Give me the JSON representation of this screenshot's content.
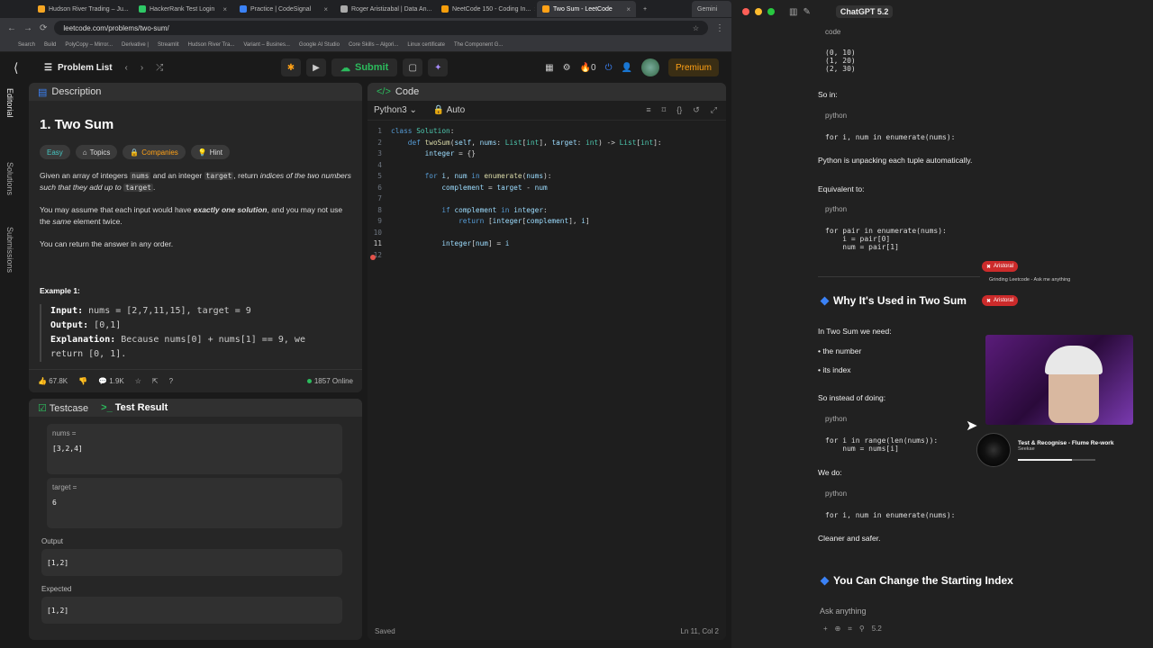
{
  "browser": {
    "tabs": [
      {
        "label": "Hudson River Trading – Ju..."
      },
      {
        "label": "HackerRank Test Login"
      },
      {
        "label": "Practice | CodeSignal"
      },
      {
        "label": "Roger Aristizabal | Data An..."
      },
      {
        "label": "NeetCode 150 - Coding In..."
      },
      {
        "label": "Two Sum - LeetCode"
      }
    ],
    "extra_tab": "Gemini",
    "url": "leetcode.com/problems/two-sum/",
    "bookmarks": [
      "Search",
      "Build",
      "PolyCopy – Mirror...",
      "Derivative |",
      "Streamlit",
      "Hudson River Tra...",
      "Variant – Busines...",
      "Google AI Studio",
      "Core Skills – Algori...",
      "Linux certificate",
      "The Component G..."
    ]
  },
  "lc_nav": {
    "problem_list": "Problem List",
    "submit": "Submit",
    "streak": "0",
    "premium": "Premium"
  },
  "rail": {
    "editorial": "Editorial",
    "solutions": "Solutions",
    "submissions": "Submissions"
  },
  "description": {
    "panel_title": "Description",
    "title": "1. Two Sum",
    "chips": {
      "easy": "Easy",
      "topics": "Topics",
      "companies": "Companies",
      "hint": "Hint"
    },
    "p1a": "Given an array of integers ",
    "p1_nums": "nums",
    "p1b": " and an integer ",
    "p1_target": "target",
    "p1c": ", return ",
    "p1d": "indices of the two numbers such that they add up to ",
    "p1_target2": "target",
    "p1e": ".",
    "p2a": "You may assume that each input would have ",
    "p2b": "exactly one solution",
    "p2c": ", and you may not use the ",
    "p2d": "same",
    "p2e": " element twice.",
    "p3": "You can return the answer in any order.",
    "example_title": "Example 1:",
    "ex_input_label": "Input:",
    "ex_input": " nums = [2,7,11,15], target = 9",
    "ex_output_label": "Output:",
    "ex_output": " [0,1]",
    "ex_expl_label": "Explanation:",
    "ex_expl": " Because nums[0] + nums[1] == 9, we",
    "ex_expl2": "return [0, 1].",
    "likes": "67.8K",
    "comments": "1.9K",
    "online": "1857 Online"
  },
  "tests": {
    "tab1": "Testcase",
    "tab2": "Test Result",
    "nums_label": "nums =",
    "nums_value": "[3,2,4]",
    "target_label": "target =",
    "target_value": "6",
    "output_label": "Output",
    "output_value": "[1,2]",
    "expected_label": "Expected",
    "expected_value": "[1,2]"
  },
  "code": {
    "panel_title": "Code",
    "language": "Python3",
    "mode": "Auto",
    "status": "Saved",
    "cursor_pos": "Ln 11, Col 2"
  },
  "chat": {
    "title": "ChatGPT 5.2",
    "code_label": "code",
    "tuples": "(0, 10)\n(1, 20)\n(2, 30)",
    "so_in": "So in:",
    "lang_python": "python",
    "loop1": "for i, num in enumerate(nums):",
    "unpack": "Python is unpacking each tuple automatically.",
    "equiv": "Equivalent to:",
    "loop2": "for pair in enumerate(nums):\n    i = pair[0]\n    num = pair[1]",
    "h_why": "Why It's Used in Two Sum",
    "need": "In Two Sum we need:",
    "b1": "• the number",
    "b2": "• its index",
    "instead": "So instead of doing:",
    "loop3": "for i in range(len(nums)):\n    num = nums[i]",
    "we_do": "We do:",
    "loop4": "for i, num in enumerate(nums):",
    "cleaner": "Cleaner and safer.",
    "h_change": "You Can Change the Starting Index",
    "ask": "Ask anything",
    "model_tag": "5.2"
  },
  "overlay": {
    "pill_name": "Aristoral",
    "pill_sub": "Grinding Leetcode - Ask me anything",
    "song": "Test & Recognise - Flume Re-work",
    "artist": "Seekae",
    "song_progress": 0.7
  }
}
